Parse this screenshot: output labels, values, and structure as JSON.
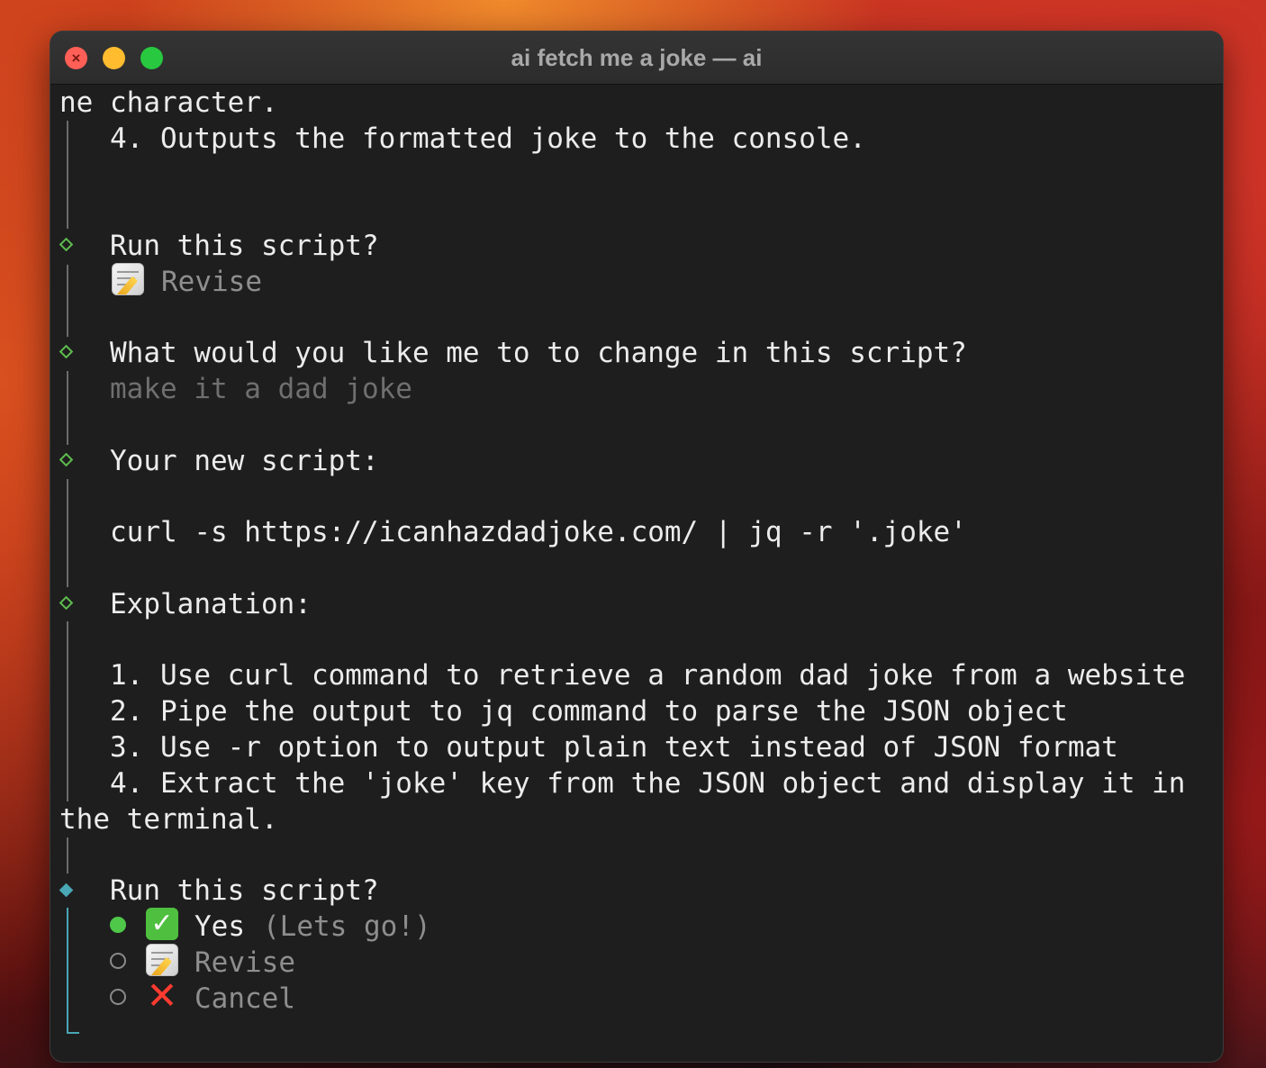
{
  "window": {
    "title": "ai fetch me a joke — ai"
  },
  "terminal": {
    "wrapped_tail": "ne character.",
    "previous_last_step": "4. Outputs the formatted joke to the console.",
    "first_prompt": {
      "question": "Run this script?",
      "answer": "Revise",
      "answer_icon": "memo-icon"
    },
    "change_prompt": {
      "question": "What would you like me to to change in this script?",
      "answer": "make it a dad joke"
    },
    "new_script": {
      "heading": "Your new script:",
      "command": "curl -s https://icanhazdadjoke.com/ | jq -r '.joke'"
    },
    "explanation": {
      "heading": "Explanation:",
      "steps": [
        "1. Use curl command to retrieve a random dad joke from a website",
        "2. Pipe the output to jq command to parse the JSON object",
        "3. Use -r option to output plain text instead of JSON format",
        "4. Extract the 'joke' key from the JSON object and display it in"
      ],
      "wrap": "the terminal."
    },
    "final_prompt": {
      "question": "Run this script?",
      "options": [
        {
          "label": "Yes",
          "hint": "(Lets go!)",
          "icon": "check-mark-icon",
          "selected": true
        },
        {
          "label": "Revise",
          "hint": "",
          "icon": "memo-icon",
          "selected": false
        },
        {
          "label": "Cancel",
          "hint": "",
          "icon": "cross-mark-icon",
          "selected": false
        }
      ]
    }
  },
  "colors": {
    "terminal_bg": "#1e1e1e",
    "text": "#ececec",
    "muted_text": "#8e8e8e",
    "done_marker": "#5fbd4f",
    "active_marker": "#4aa7b5",
    "selected_radio": "#4fc84a"
  }
}
